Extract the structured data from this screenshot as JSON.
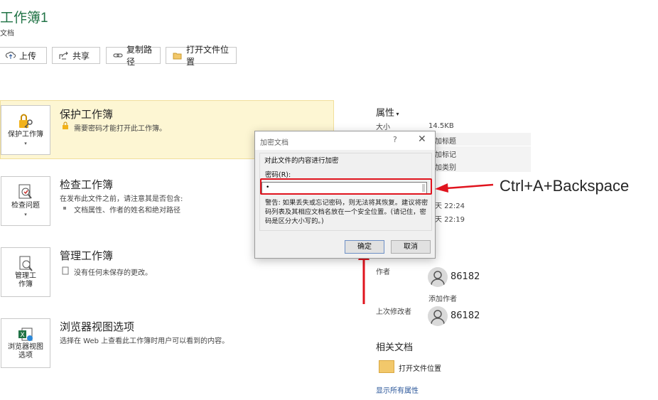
{
  "header": {
    "title": "工作簿1",
    "subtitle": "文档"
  },
  "toolbar": {
    "upload": "上传",
    "share": "共享",
    "copy_path": "复制路径",
    "open_location": "打开文件位置"
  },
  "sections": {
    "protect": {
      "tile_label": "保护工作簿",
      "heading": "保护工作簿",
      "text": "需要密码才能打开此工作簿。"
    },
    "inspect": {
      "tile_label": "检查问题",
      "heading": "检查工作簿",
      "text": "在发布此文件之前，请注意其是否包含:",
      "bullet": "文档属性、作者的姓名和绝对路径"
    },
    "manage": {
      "tile_label_1": "管理工",
      "tile_label_2": "作簿",
      "heading": "管理工作簿",
      "text": "没有任何未保存的更改。"
    },
    "browser": {
      "tile_label_1": "浏览器视图",
      "tile_label_2": "选项",
      "heading": "浏览器视图选项",
      "text": "选择在 Web 上查看此工作簿时用户可以看到的内容。"
    }
  },
  "properties": {
    "heading": "属性",
    "size_label": "大小",
    "size_value": "14.5KB",
    "title_placeholder": "加标题",
    "tags_placeholder": "加标记",
    "category_placeholder": "加类别",
    "time1": "天 22:24",
    "time2": "天 22:19",
    "author_label": "作者",
    "author_name": "86182",
    "add_author": "添加作者",
    "last_modified_label": "上次修改者",
    "last_modified_name": "86182",
    "related_docs": "相关文档",
    "open_location": "打开文件位置",
    "show_all": "显示所有属性"
  },
  "dialog": {
    "title": "加密文档",
    "help": "?",
    "close": "✕",
    "group_label": "对此文件的内容进行加密",
    "password_label": "密码(R):",
    "password_value": "•",
    "warning": "警告: 如果丢失或忘记密码，则无法将其恢复。建议将密码列表及其相应文档名放在一个安全位置。(请记住，密码是区分大小写的。)",
    "ok": "确定",
    "cancel": "取消"
  },
  "annotation": {
    "hint": "Ctrl+A+Backspace"
  },
  "colors": {
    "accent": "#217346",
    "highlight": "#e0141e",
    "banner": "#fdf6d3",
    "link": "#2b579a"
  }
}
